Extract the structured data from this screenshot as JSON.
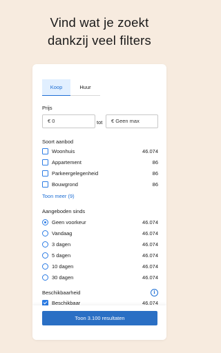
{
  "headline": {
    "line1": "Vind wat je zoekt",
    "line2": "dankzij veel filters"
  },
  "tabs": [
    {
      "label": "Koop",
      "active": true
    },
    {
      "label": "Huur",
      "active": false
    }
  ],
  "price": {
    "label": "Prijs",
    "min_value": "€ 0",
    "separator": "tot",
    "max_value": "€ Geen max"
  },
  "type_section": {
    "title": "Soort aanbod",
    "items": [
      {
        "label": "Woonhuis",
        "count": "46.074",
        "checked": false
      },
      {
        "label": "Appartement",
        "count": "86",
        "checked": false
      },
      {
        "label": "Parkeergelegenheid",
        "count": "86",
        "checked": false
      },
      {
        "label": "Bouwgrond",
        "count": "86",
        "checked": false
      }
    ],
    "more_link": "Toon meer (9)"
  },
  "since_section": {
    "title": "Aangeboden sinds",
    "items": [
      {
        "label": "Geen voorkeur",
        "count": "46.074",
        "selected": true
      },
      {
        "label": "Vandaag",
        "count": "46.074",
        "selected": false
      },
      {
        "label": "3 dagen",
        "count": "46.074",
        "selected": false
      },
      {
        "label": "5 dagen",
        "count": "46.074",
        "selected": false
      },
      {
        "label": "10 dagen",
        "count": "46.074",
        "selected": false
      },
      {
        "label": "30 dagen",
        "count": "46.074",
        "selected": false
      }
    ]
  },
  "availability_section": {
    "title": "Beschikbaarheid",
    "info_icon": "info-icon",
    "items": [
      {
        "label": "Beschikbaar",
        "count": "46.074",
        "checked": true
      }
    ]
  },
  "cta": {
    "label": "Toon 3.100 resultaten"
  },
  "colors": {
    "accent": "#2a6fc4",
    "background": "#f7ebdf",
    "tab_active_bg": "#e1efff"
  }
}
